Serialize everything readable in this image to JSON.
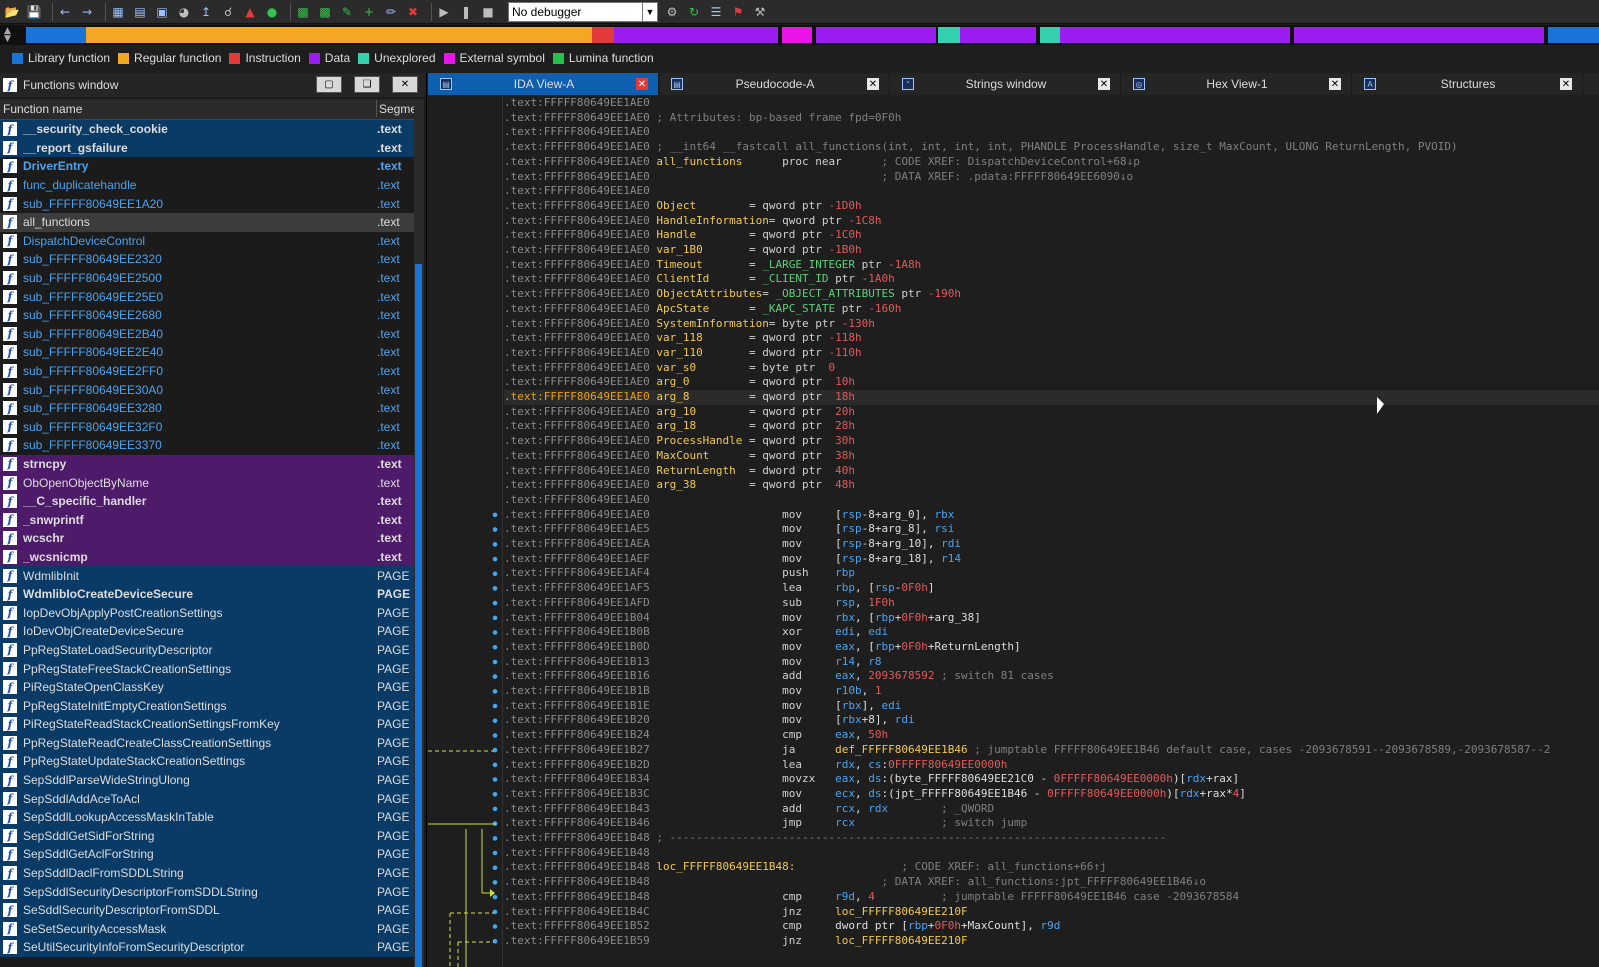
{
  "toolbar": {
    "debugger_value": "No debugger",
    "icons": [
      "open-icon",
      "save-icon",
      "back-icon",
      "forward-icon",
      "graph-icon",
      "flow-icon",
      "struct-icon",
      "pie-icon",
      "jump-icon",
      "search-icon",
      "alert-icon",
      "run-green-icon",
      "code-icon",
      "code2-icon",
      "patch-icon",
      "plus-icon",
      "edit-icon",
      "close-red-icon",
      "play-icon",
      "pause-icon",
      "stop-icon"
    ]
  },
  "nav": {
    "colors": {
      "library": "#1a73d6",
      "regular": "#f5a623",
      "instruction": "#e23a3a",
      "data": "#9b1df0",
      "unexplored": "#33d1b0",
      "external": "#e814e8",
      "lumina": "#22c24a"
    }
  },
  "legend": [
    {
      "label": "Library function",
      "color": "#1a73d6"
    },
    {
      "label": "Regular function",
      "color": "#f5a623"
    },
    {
      "label": "Instruction",
      "color": "#e23a3a"
    },
    {
      "label": "Data",
      "color": "#9b1df0"
    },
    {
      "label": "Unexplored",
      "color": "#33d1b0"
    },
    {
      "label": "External symbol",
      "color": "#e814e8"
    },
    {
      "label": "Lumina function",
      "color": "#22c24a"
    }
  ],
  "functions_window": {
    "title": "Functions window",
    "col_name": "Function name",
    "col_segment": "Segme",
    "rows": [
      {
        "name": "__security_check_cookie",
        "seg": ".text",
        "kind": "lib",
        "bold": true
      },
      {
        "name": "__report_gsfailure",
        "seg": ".text",
        "kind": "lib",
        "bold": true
      },
      {
        "name": "DriverEntry",
        "seg": ".text",
        "kind": "reg",
        "bold": true
      },
      {
        "name": "func_duplicatehandle",
        "seg": ".text",
        "kind": "reg",
        "bold": false
      },
      {
        "name": "sub_FFFFF80649EE1A20",
        "seg": ".text",
        "kind": "reg",
        "bold": false
      },
      {
        "name": "all_functions",
        "seg": ".text",
        "kind": "sel",
        "bold": false
      },
      {
        "name": "DispatchDeviceControl",
        "seg": ".text",
        "kind": "reg",
        "bold": false
      },
      {
        "name": "sub_FFFFF80649EE2320",
        "seg": ".text",
        "kind": "reg",
        "bold": false
      },
      {
        "name": "sub_FFFFF80649EE2500",
        "seg": ".text",
        "kind": "reg",
        "bold": false
      },
      {
        "name": "sub_FFFFF80649EE25E0",
        "seg": ".text",
        "kind": "reg",
        "bold": false
      },
      {
        "name": "sub_FFFFF80649EE2680",
        "seg": ".text",
        "kind": "reg",
        "bold": false
      },
      {
        "name": "sub_FFFFF80649EE2B40",
        "seg": ".text",
        "kind": "reg",
        "bold": false
      },
      {
        "name": "sub_FFFFF80649EE2E40",
        "seg": ".text",
        "kind": "reg",
        "bold": false
      },
      {
        "name": "sub_FFFFF80649EE2FF0",
        "seg": ".text",
        "kind": "reg",
        "bold": false
      },
      {
        "name": "sub_FFFFF80649EE30A0",
        "seg": ".text",
        "kind": "reg",
        "bold": false
      },
      {
        "name": "sub_FFFFF80649EE3280",
        "seg": ".text",
        "kind": "reg",
        "bold": false
      },
      {
        "name": "sub_FFFFF80649EE32F0",
        "seg": ".text",
        "kind": "reg",
        "bold": false
      },
      {
        "name": "sub_FFFFF80649EE3370",
        "seg": ".text",
        "kind": "reg",
        "bold": false
      },
      {
        "name": "strncpy",
        "seg": ".text",
        "kind": "ext",
        "bold": true
      },
      {
        "name": "ObOpenObjectByName",
        "seg": ".text",
        "kind": "ext",
        "bold": false
      },
      {
        "name": "__C_specific_handler",
        "seg": ".text",
        "kind": "ext",
        "bold": true
      },
      {
        "name": "_snwprintf",
        "seg": ".text",
        "kind": "ext",
        "bold": true
      },
      {
        "name": "wcschr",
        "seg": ".text",
        "kind": "ext",
        "bold": true
      },
      {
        "name": "_wcsnicmp",
        "seg": ".text",
        "kind": "ext",
        "bold": true
      },
      {
        "name": "WdmlibInit",
        "seg": "PAGE",
        "kind": "lib",
        "bold": false
      },
      {
        "name": "WdmlibIoCreateDeviceSecure",
        "seg": "PAGE",
        "kind": "lib",
        "bold": true
      },
      {
        "name": "IopDevObjApplyPostCreationSettings",
        "seg": "PAGE",
        "kind": "lib",
        "bold": false
      },
      {
        "name": "IoDevObjCreateDeviceSecure",
        "seg": "PAGE",
        "kind": "lib",
        "bold": false
      },
      {
        "name": "PpRegStateLoadSecurityDescriptor",
        "seg": "PAGE",
        "kind": "lib",
        "bold": false
      },
      {
        "name": "PpRegStateFreeStackCreationSettings",
        "seg": "PAGE",
        "kind": "lib",
        "bold": false
      },
      {
        "name": "PiRegStateOpenClassKey",
        "seg": "PAGE",
        "kind": "lib",
        "bold": false
      },
      {
        "name": "PpRegStateInitEmptyCreationSettings",
        "seg": "PAGE",
        "kind": "lib",
        "bold": false
      },
      {
        "name": "PiRegStateReadStackCreationSettingsFromKey",
        "seg": "PAGE",
        "kind": "lib",
        "bold": false
      },
      {
        "name": "PpRegStateReadCreateClassCreationSettings",
        "seg": "PAGE",
        "kind": "lib",
        "bold": false
      },
      {
        "name": "PpRegStateUpdateStackCreationSettings",
        "seg": "PAGE",
        "kind": "lib",
        "bold": false
      },
      {
        "name": "SepSddlParseWideStringUlong",
        "seg": "PAGE",
        "kind": "lib",
        "bold": false
      },
      {
        "name": "SepSddlAddAceToAcl",
        "seg": "PAGE",
        "kind": "lib",
        "bold": false
      },
      {
        "name": "SepSddlLookupAccessMaskInTable",
        "seg": "PAGE",
        "kind": "lib",
        "bold": false
      },
      {
        "name": "SepSddlGetSidForString",
        "seg": "PAGE",
        "kind": "lib",
        "bold": false
      },
      {
        "name": "SepSddlGetAclForString",
        "seg": "PAGE",
        "kind": "lib",
        "bold": false
      },
      {
        "name": "SepSddlDaclFromSDDLString",
        "seg": "PAGE",
        "kind": "lib",
        "bold": false
      },
      {
        "name": "SepSddlSecurityDescriptorFromSDDLString",
        "seg": "PAGE",
        "kind": "lib",
        "bold": false
      },
      {
        "name": "SeSddlSecurityDescriptorFromSDDL",
        "seg": "PAGE",
        "kind": "lib",
        "bold": false
      },
      {
        "name": "SeSetSecurityAccessMask",
        "seg": "PAGE",
        "kind": "lib",
        "bold": false
      },
      {
        "name": "SeUtilSecurityInfoFromSecurityDescriptor",
        "seg": "PAGE",
        "kind": "lib",
        "bold": false
      }
    ]
  },
  "tabs": [
    {
      "label": "IDA View-A",
      "active": true
    },
    {
      "label": "Pseudocode-A",
      "active": false
    },
    {
      "label": "Strings window",
      "active": false
    },
    {
      "label": "Hex View-1",
      "active": false
    },
    {
      "label": "Structures",
      "active": false
    }
  ],
  "code_lines": [
    {
      "addr": ".text:FFFFF80649EE1AE0",
      "text": ""
    },
    {
      "addr": ".text:FFFFF80649EE1AE0",
      "cmt": "; Attributes: bp-based frame fpd=0F0h"
    },
    {
      "addr": ".text:FFFFF80649EE1AE0",
      "text": ""
    },
    {
      "addr": ".text:FFFFF80649EE1AE0",
      "cmt": "; __int64 __fastcall all_functions(int, int, int, int, PHANDLE ProcessHandle, size_t MaxCount, ULONG ReturnLength, PVOID)"
    },
    {
      "addr": ".text:FFFFF80649EE1AE0",
      "label": "all_functions",
      "op": "proc near",
      "xref": "; CODE XREF: DispatchDeviceControl+68↓p"
    },
    {
      "addr": ".text:FFFFF80649EE1AE0",
      "xref2": "; DATA XREF: .pdata:FFFFF80649EE6090↓o"
    },
    {
      "addr": ".text:FFFFF80649EE1AE0",
      "text": ""
    },
    {
      "addr": ".text:FFFFF80649EE1AE0",
      "var": "Object",
      "def": "= qword ptr ",
      "num": "-1D0h"
    },
    {
      "addr": ".text:FFFFF80649EE1AE0",
      "var": "HandleInformation",
      "def": "= qword ptr ",
      "num": "-1C8h"
    },
    {
      "addr": ".text:FFFFF80649EE1AE0",
      "var": "Handle",
      "def": "= qword ptr ",
      "num": "-1C0h"
    },
    {
      "addr": ".text:FFFFF80649EE1AE0",
      "var": "var_1B0",
      "def": "= qword ptr ",
      "num": "-1B0h"
    },
    {
      "addr": ".text:FFFFF80649EE1AE0",
      "var": "Timeout",
      "def": "= _LARGE_INTEGER ptr ",
      "num": "-1A8h"
    },
    {
      "addr": ".text:FFFFF80649EE1AE0",
      "var": "ClientId",
      "def": "= _CLIENT_ID ptr ",
      "num": "-1A0h"
    },
    {
      "addr": ".text:FFFFF80649EE1AE0",
      "var": "ObjectAttributes",
      "def": "= _OBJECT_ATTRIBUTES ptr ",
      "num": "-190h"
    },
    {
      "addr": ".text:FFFFF80649EE1AE0",
      "var": "ApcState",
      "def": "= _KAPC_STATE ptr ",
      "num": "-160h"
    },
    {
      "addr": ".text:FFFFF80649EE1AE0",
      "var": "SystemInformation",
      "def": "= byte ptr ",
      "num": "-130h"
    },
    {
      "addr": ".text:FFFFF80649EE1AE0",
      "var": "var_118",
      "def": "= qword ptr ",
      "num": "-118h"
    },
    {
      "addr": ".text:FFFFF80649EE1AE0",
      "var": "var_110",
      "def": "= dword ptr ",
      "num": "-110h"
    },
    {
      "addr": ".text:FFFFF80649EE1AE0",
      "var": "var_s0",
      "def": "= byte ptr  ",
      "num": "0"
    },
    {
      "addr": ".text:FFFFF80649EE1AE0",
      "var": "arg_0",
      "def": "= qword ptr  ",
      "num": "10h"
    },
    {
      "addr": ".text:FFFFF80649EE1AE0",
      "var": "arg_8",
      "def": "= qword ptr  ",
      "num": "18h",
      "hl": true
    },
    {
      "addr": ".text:FFFFF80649EE1AE0",
      "var": "arg_10",
      "def": "= qword ptr  ",
      "num": "20h"
    },
    {
      "addr": ".text:FFFFF80649EE1AE0",
      "var": "arg_18",
      "def": "= qword ptr  ",
      "num": "28h"
    },
    {
      "addr": ".text:FFFFF80649EE1AE0",
      "var": "ProcessHandle",
      "def": "= qword ptr  ",
      "num": "30h"
    },
    {
      "addr": ".text:FFFFF80649EE1AE0",
      "var": "MaxCount",
      "def": "= qword ptr  ",
      "num": "38h"
    },
    {
      "addr": ".text:FFFFF80649EE1AE0",
      "var": "ReturnLength",
      "def": "= dword ptr  ",
      "num": "40h"
    },
    {
      "addr": ".text:FFFFF80649EE1AE0",
      "var": "arg_38",
      "def": "= qword ptr  ",
      "num": "48h"
    },
    {
      "addr": ".text:FFFFF80649EE1AE0",
      "text": ""
    },
    {
      "addr": ".text:FFFFF80649EE1AE0",
      "mn": "mov",
      "ops": "[rsp-8+arg_0], rbx"
    },
    {
      "addr": ".text:FFFFF80649EE1AE5",
      "mn": "mov",
      "ops": "[rsp-8+arg_8], rsi"
    },
    {
      "addr": ".text:FFFFF80649EE1AEA",
      "mn": "mov",
      "ops": "[rsp-8+arg_10], rdi"
    },
    {
      "addr": ".text:FFFFF80649EE1AEF",
      "mn": "mov",
      "ops": "[rsp-8+arg_18], r14"
    },
    {
      "addr": ".text:FFFFF80649EE1AF4",
      "mn": "push",
      "ops": "rbp"
    },
    {
      "addr": ".text:FFFFF80649EE1AF5",
      "mn": "lea",
      "ops": "rbp, [rsp-0F0h]"
    },
    {
      "addr": ".text:FFFFF80649EE1AFD",
      "mn": "sub",
      "ops": "rsp, 1F0h"
    },
    {
      "addr": ".text:FFFFF80649EE1B04",
      "mn": "mov",
      "ops": "rbx, [rbp+0F0h+arg_38]"
    },
    {
      "addr": ".text:FFFFF80649EE1B0B",
      "mn": "xor",
      "ops": "edi, edi"
    },
    {
      "addr": ".text:FFFFF80649EE1B0D",
      "mn": "mov",
      "ops": "eax, [rbp+0F0h+ReturnLength]"
    },
    {
      "addr": ".text:FFFFF80649EE1B13",
      "mn": "mov",
      "ops": "r14, r8"
    },
    {
      "addr": ".text:FFFFF80649EE1B16",
      "mn": "add",
      "ops": "eax, 2093678592 ; switch 81 cases"
    },
    {
      "addr": ".text:FFFFF80649EE1B1B",
      "mn": "mov",
      "ops": "r10b, 1"
    },
    {
      "addr": ".text:FFFFF80649EE1B1E",
      "mn": "mov",
      "ops": "[rbx], edi"
    },
    {
      "addr": ".text:FFFFF80649EE1B20",
      "mn": "mov",
      "ops": "[rbx+8], rdi"
    },
    {
      "addr": ".text:FFFFF80649EE1B24",
      "mn": "cmp",
      "ops": "eax, 50h"
    },
    {
      "addr": ".text:FFFFF80649EE1B27",
      "mn": "ja",
      "ops": "def_FFFFF80649EE1B46 ; jumptable FFFFF80649EE1B46 default case, cases -2093678591--2093678589,-2093678587--2"
    },
    {
      "addr": ".text:FFFFF80649EE1B2D",
      "mn": "lea",
      "ops": "rdx, cs:0FFFFF80649EE0000h"
    },
    {
      "addr": ".text:FFFFF80649EE1B34",
      "mn": "movzx",
      "ops": "eax, ds:(byte_FFFFF80649EE21C0 - 0FFFFF80649EE0000h)[rdx+rax]"
    },
    {
      "addr": ".text:FFFFF80649EE1B3C",
      "mn": "mov",
      "ops": "ecx, ds:(jpt_FFFFF80649EE1B46 - 0FFFFF80649EE0000h)[rdx+rax*4]"
    },
    {
      "addr": ".text:FFFFF80649EE1B43",
      "mn": "add",
      "ops": "rcx, rdx        ; _QWORD"
    },
    {
      "addr": ".text:FFFFF80649EE1B46",
      "mn": "jmp",
      "ops": "rcx             ; switch jump"
    },
    {
      "addr": ".text:FFFFF80649EE1B48",
      "cmt": "; ---------------------------------------------------------------------------"
    },
    {
      "addr": ".text:FFFFF80649EE1B48",
      "text": ""
    },
    {
      "addr": ".text:FFFFF80649EE1B48",
      "label": "loc_FFFFF80649EE1B48:",
      "op": "",
      "xref": "; CODE XREF: all_functions+66↑j"
    },
    {
      "addr": ".text:FFFFF80649EE1B48",
      "xref2": "; DATA XREF: all_functions:jpt_FFFFF80649EE1B46↓o"
    },
    {
      "addr": ".text:FFFFF80649EE1B48",
      "mn": "cmp",
      "ops": "r9d, 4          ; jumptable FFFFF80649EE1B46 case -2093678584"
    },
    {
      "addr": ".text:FFFFF80649EE1B4C",
      "mn": "jnz",
      "ops": "loc_FFFFF80649EE210F"
    },
    {
      "addr": ".text:FFFFF80649EE1B52",
      "mn": "cmp",
      "ops": "dword ptr [rbp+0F0h+MaxCount], r9d"
    },
    {
      "addr": ".text:FFFFF80649EE1B59",
      "mn": "jnz",
      "ops": "loc_FFFFF80649EE210F"
    }
  ]
}
